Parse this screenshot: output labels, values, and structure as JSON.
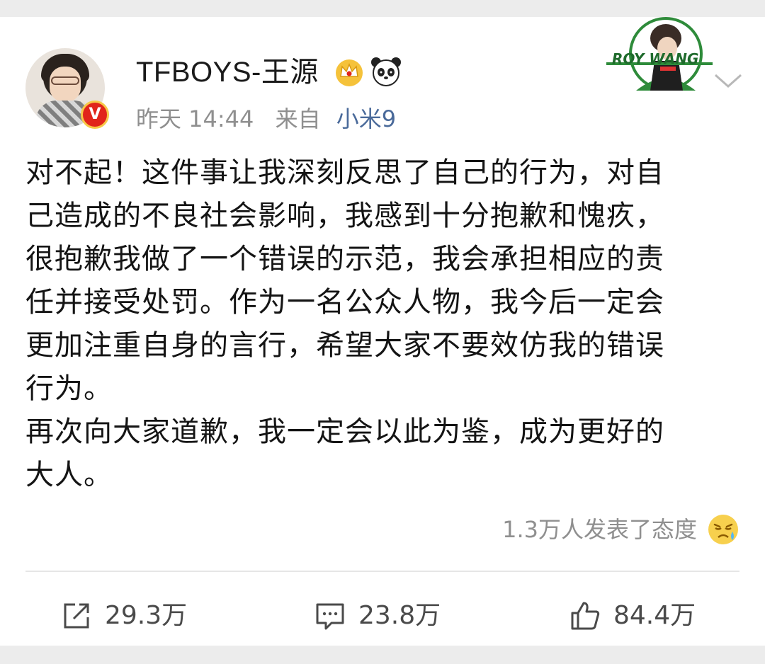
{
  "post": {
    "username": "TFBOYS-王源",
    "time": "昨天 14:44",
    "from_label": "来自",
    "device": "小米9",
    "verified_badge": "V",
    "badge_text": "ROY WANG",
    "content_lines": [
      "对不起！这件事让我深刻反思了自己的行为，对自",
      "己造成的不良社会影响，我感到十分抱歉和愧疚，",
      "很抱歉我做了一个错误的示范，我会承担相应的责",
      "任并接受处罚。作为一名公众人物，我今后一定会",
      "更加注重自身的言行，希望大家不要效仿我的错误",
      "行为。",
      "再次向大家道歉，我一定会以此为鉴，成为更好的",
      "大人。"
    ],
    "attitude_text": "1.3万人发表了态度"
  },
  "actions": {
    "repost_count": "29.3万",
    "comment_count": "23.8万",
    "like_count": "84.4万"
  },
  "icons": {
    "verified": "verified-v-icon",
    "crown": "crown-icon",
    "panda": "panda-icon",
    "chevron": "chevron-down-icon",
    "emoji": "tear-face-emoji-icon",
    "repost": "repost-icon",
    "comment": "comment-icon",
    "like": "thumbs-up-icon"
  },
  "colors": {
    "link": "#4a6a9a",
    "muted": "#8f8f8f",
    "verified_red": "#e1251b",
    "badge_green": "#2e8b3a"
  }
}
